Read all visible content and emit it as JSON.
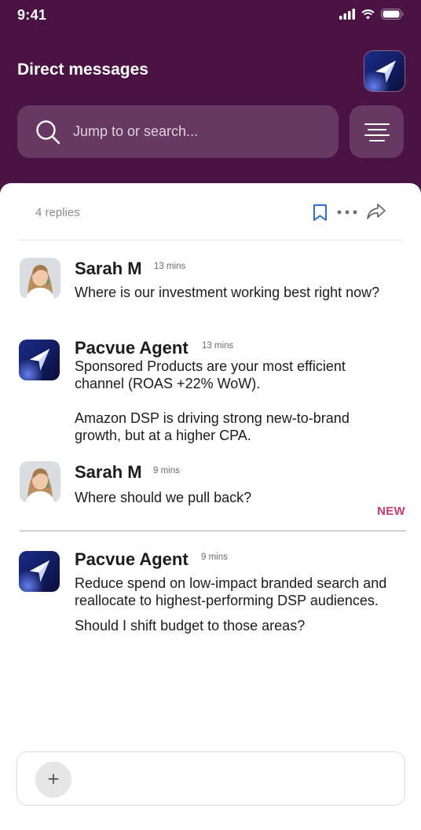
{
  "status_bar": {
    "time": "9:41"
  },
  "header": {
    "title": "Direct messages",
    "search_placeholder": "Jump to or search..."
  },
  "thread": {
    "replies": "4 replies"
  },
  "messages": [
    {
      "author": "Sarah M",
      "time": "13 mins",
      "avatar": "person-avatar",
      "paragraphs": [
        "Where is our investment working best right now?"
      ]
    },
    {
      "author": "Pacvue Agent",
      "time": "13 mins",
      "avatar": "agent-logo",
      "paragraphs": [
        "Sponsored Products are your most efficient channel (ROAS +22% WoW).",
        "Amazon DSP is driving strong new-to-brand growth, but at a higher CPA."
      ]
    },
    {
      "author": "Sarah M",
      "time": "9 mins",
      "avatar": "person-avatar",
      "paragraphs": [
        "Where should we pull back?"
      ]
    },
    {
      "author": "Pacvue Agent",
      "time": "9 mins",
      "avatar": "agent-logo",
      "paragraphs": [
        "Reduce spend on low-impact branded search and reallocate to highest-performing DSP audiences.",
        "Should I shift budget to those areas?"
      ]
    }
  ],
  "new_label": "NEW",
  "composer": {
    "add_label": "+"
  },
  "colors": {
    "header_bg": "#4a1344",
    "accent": "#d03a6b",
    "link_blue": "#2d6fd6"
  },
  "icons": [
    "signal-icon",
    "wifi-icon",
    "battery-icon",
    "search-icon",
    "filter-icon",
    "bookmark-icon",
    "more-icon",
    "share-icon",
    "plus-icon"
  ]
}
